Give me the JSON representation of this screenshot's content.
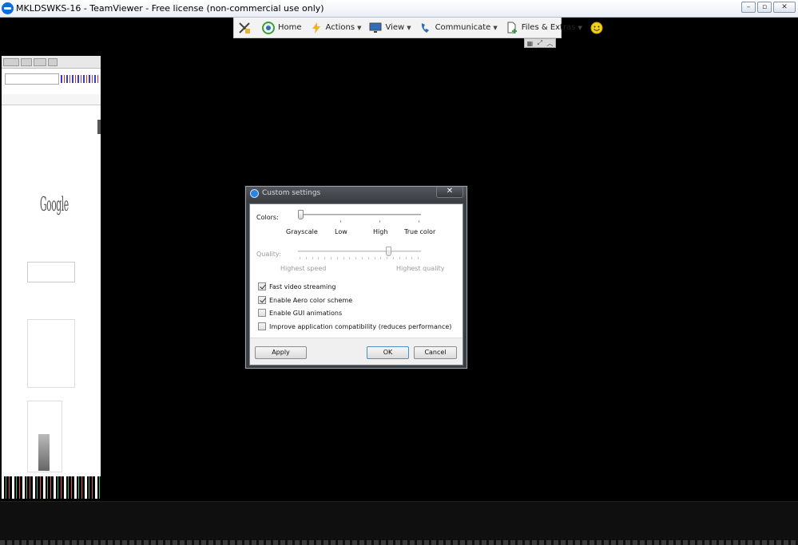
{
  "window": {
    "title": "MKLDSWKS-16 - TeamViewer - Free license (non-commercial use only)",
    "controls": {
      "minimize": "–",
      "maximize": "▫",
      "close": "✕"
    }
  },
  "toolbar": {
    "items": [
      {
        "label": "",
        "icon": "close-connection-icon"
      },
      {
        "label": "Home",
        "icon": "home-icon"
      },
      {
        "label": "Actions",
        "icon": "lightning-icon"
      },
      {
        "label": "View",
        "icon": "monitor-icon"
      },
      {
        "label": "Communicate",
        "icon": "phone-icon"
      },
      {
        "label": "Files & Extras",
        "icon": "file-add-icon"
      },
      {
        "label": "",
        "icon": "smiley-icon"
      }
    ],
    "colors": {
      "lightning": "#f2b21a",
      "home": "#3aa03a",
      "blue": "#2f6fb8"
    }
  },
  "dialog": {
    "title": "Custom settings",
    "close_label": "✕",
    "colors_label": "Colors:",
    "colors_ticks": [
      "Grayscale",
      "Low",
      "High",
      "True color"
    ],
    "colors_level": 0,
    "quality_label": "Quality:",
    "quality_min": "Highest speed",
    "quality_max": "Highest quality",
    "quality_level": 0.75,
    "options": [
      {
        "label": "Fast video streaming",
        "checked": true
      },
      {
        "label": "Enable Aero color scheme",
        "checked": true
      },
      {
        "label": "Enable GUI animations",
        "checked": false
      },
      {
        "label": "Improve application compatibility (reduces performance)",
        "checked": false
      }
    ],
    "buttons": {
      "apply": "Apply",
      "ok": "OK",
      "cancel": "Cancel"
    }
  }
}
